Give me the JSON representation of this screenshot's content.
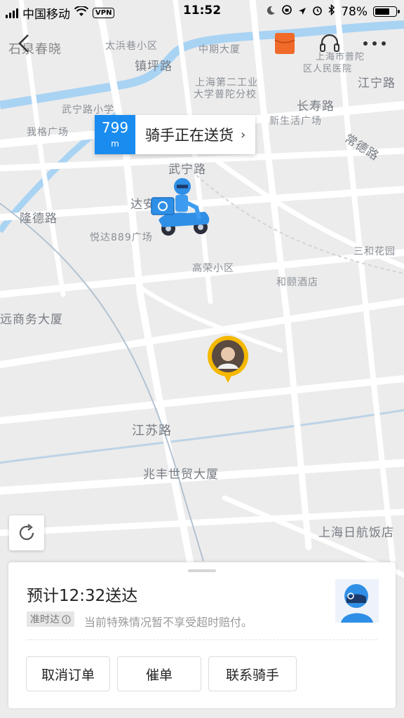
{
  "status_bar": {
    "carrier": "中国移动",
    "vpn": "VPN",
    "time": "11:52",
    "battery_percent": "78%",
    "battery_level": 0.78
  },
  "map_labels": [
    "石泉春晓",
    "太浜巷小区",
    "中期大厦",
    "镇坪路",
    "上海第二工业",
    "大学普陀分校",
    "上海市普陀",
    "区人民医院",
    "江宁路",
    "长寿路",
    "武宁路小学",
    "新生活广场",
    "我格广场",
    "常德路",
    "武宁路",
    "达安花",
    "隆德路",
    "悦达889广场",
    "三和花园",
    "高荣小区",
    "和颐酒店",
    "远商务大厦",
    "江苏路",
    "兆丰世贸大厦",
    "上海日航饭店"
  ],
  "rider_bubble": {
    "distance": "799",
    "unit": "m",
    "status": "骑手正在送货"
  },
  "order_panel": {
    "eta": "预计12:32送达",
    "ontime_badge": "准时达",
    "ontime_note": "当前特殊情况暂不享受超时赔付。",
    "buttons": {
      "cancel": "取消订单",
      "urge": "催单",
      "contact": "联系骑手"
    }
  },
  "colors": {
    "accent_blue": "#1a8cf0",
    "river": "#a9d3f3",
    "orange": "#f06a2a",
    "pin_yellow": "#f5b800"
  }
}
